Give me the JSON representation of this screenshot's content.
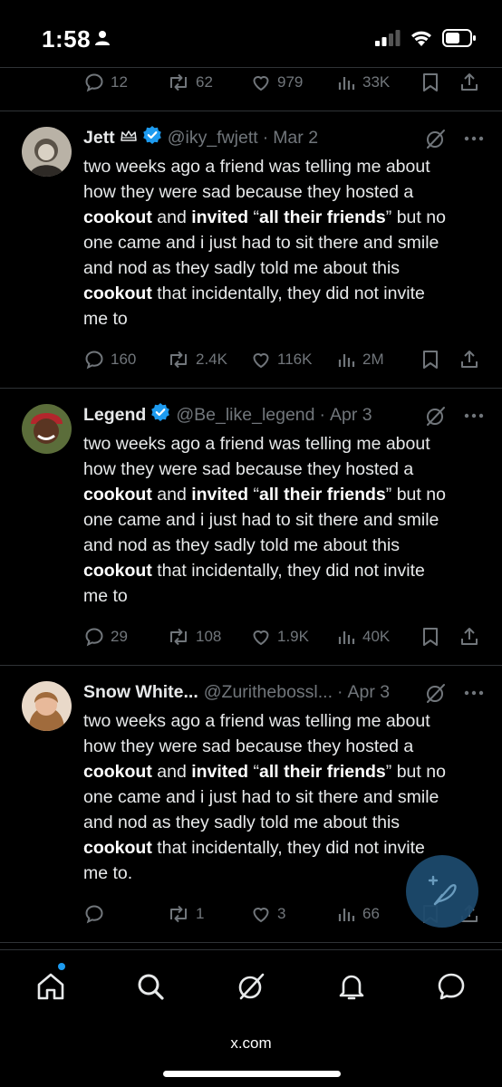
{
  "status_bar": {
    "time": "1:58"
  },
  "top_tweet_stats": {
    "replies": "12",
    "retweets": "62",
    "likes": "979",
    "views": "33K"
  },
  "tweets": [
    {
      "name": "Jett",
      "handle": "@iky_fwjett",
      "date": "Mar 2",
      "text_lines": [
        [
          "two weeks ago a friend was telling me about"
        ],
        [
          "how they were sad because they hosted a"
        ],
        [
          {
            "b": "cookout"
          },
          " and ",
          {
            "b": "invited"
          },
          " “",
          {
            "b": "all their friends"
          },
          "” but no"
        ],
        [
          "one came and i just had to sit there and smile"
        ],
        [
          "and nod as they sadly told me about this"
        ],
        [
          {
            "b": "cookout"
          },
          " that incidentally, they did not invite"
        ],
        [
          "me to"
        ]
      ],
      "stats": {
        "replies": "160",
        "retweets": "2.4K",
        "likes": "116K",
        "views": "2M"
      }
    },
    {
      "name": "Legend",
      "handle": "@Be_like_legend",
      "date": "Apr 3",
      "text_lines": [
        [
          "two weeks ago a friend was telling me about"
        ],
        [
          "how they were sad because they hosted a"
        ],
        [
          {
            "b": "cookout"
          },
          " and ",
          {
            "b": "invited"
          },
          " “",
          {
            "b": "all their friends"
          },
          "” but no"
        ],
        [
          "one came and i just had to sit there and smile"
        ],
        [
          "and nod as they sadly told me about this"
        ],
        [
          {
            "b": "cookout"
          },
          " that incidentally, they did not invite"
        ],
        [
          "me to"
        ]
      ],
      "stats": {
        "replies": "29",
        "retweets": "108",
        "likes": "1.9K",
        "views": "40K"
      }
    },
    {
      "name": "Snow White...",
      "handle": "@Zurithebossl...",
      "date": "Apr 3",
      "text_lines": [
        [
          "two weeks ago a friend was telling me about"
        ],
        [
          "how they were sad because they hosted a"
        ],
        [
          {
            "b": "cookout"
          },
          " and ",
          {
            "b": "invited"
          },
          " “",
          {
            "b": "all their friends"
          },
          "” but no"
        ],
        [
          "one came and i just had to sit there and smile"
        ],
        [
          "and nod as they sadly told me about this"
        ],
        [
          {
            "b": "cookout"
          },
          " that incidentally, they did not invite"
        ],
        [
          "me to."
        ]
      ],
      "stats": {
        "replies": "",
        "retweets": "1",
        "likes": "3",
        "views": "66"
      }
    }
  ],
  "browser": {
    "url": "x.com"
  },
  "colors": {
    "background": "#000000",
    "text": "#e7e9ea",
    "muted": "#71767b",
    "divider": "#2f3336",
    "verified_blue": "#1d9bf0",
    "fab": "#1d4a6d"
  }
}
